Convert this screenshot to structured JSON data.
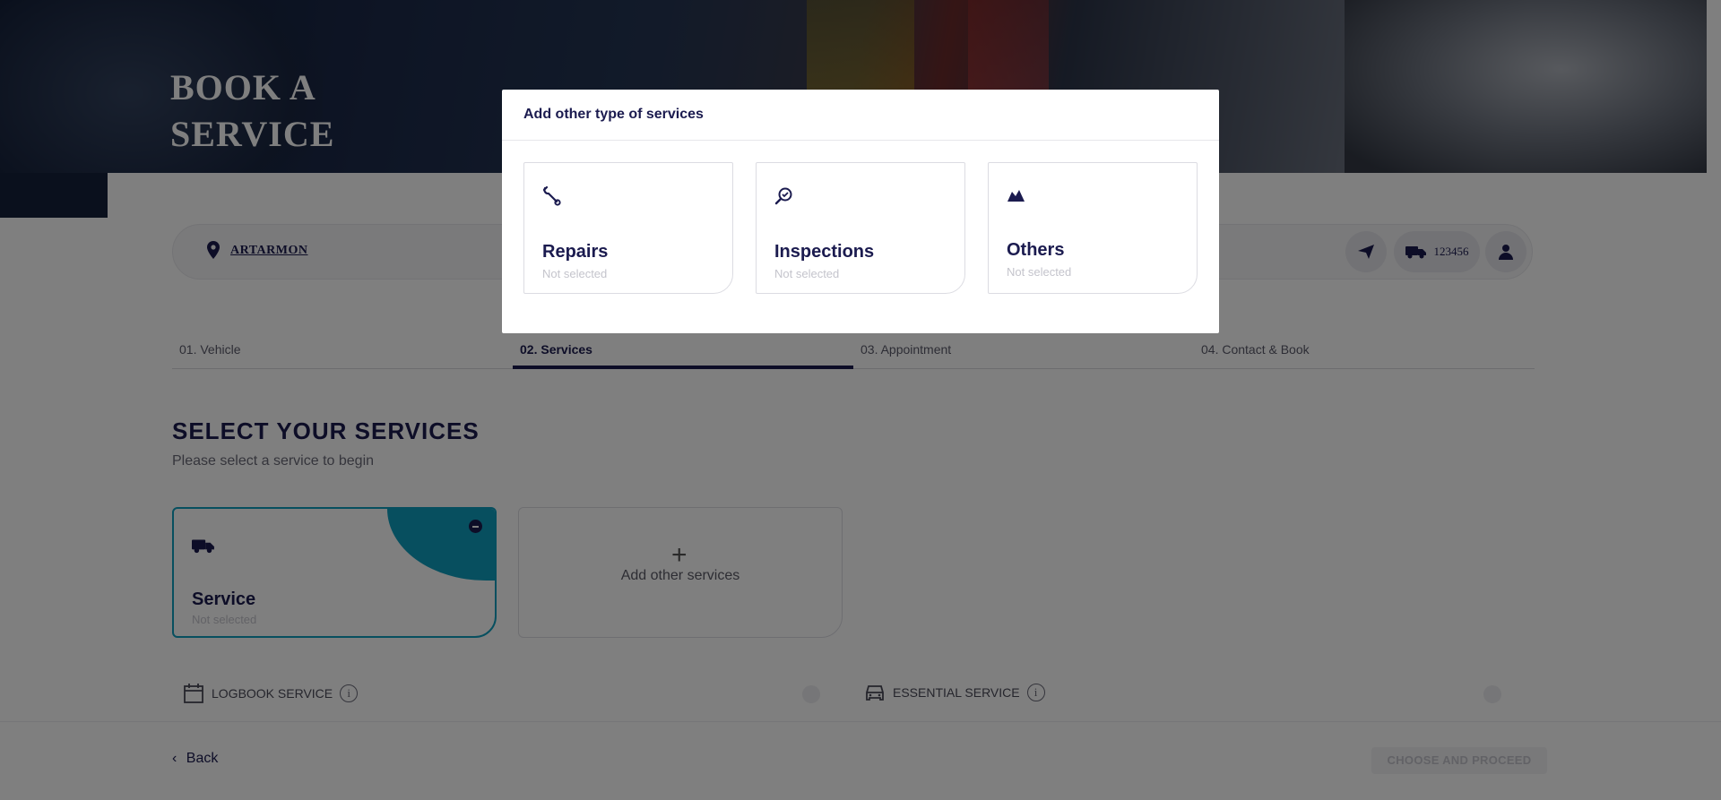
{
  "hero": {
    "title_line1": "BOOK A",
    "title_line2": "SERVICE"
  },
  "location": {
    "name": "ARTARMON"
  },
  "vehicle": {
    "rego": "123456"
  },
  "steps": [
    {
      "label": "01. Vehicle"
    },
    {
      "label": "02. Services"
    },
    {
      "label": "03. Appointment"
    },
    {
      "label": "04. Contact & Book"
    }
  ],
  "section": {
    "title": "SELECT YOUR SERVICES",
    "subtitle": "Please select a service to begin"
  },
  "service_card": {
    "name": "Service",
    "state": "Not selected"
  },
  "add_card": {
    "plus": "+",
    "label": "Add other services"
  },
  "options": [
    {
      "label": "LOGBOOK SERVICE",
      "info": "i"
    },
    {
      "label": "ESSENTIAL SERVICE",
      "info": "i"
    }
  ],
  "footer": {
    "back_label": "Back",
    "proceed_label": "CHOOSE AND PROCEED"
  },
  "modal": {
    "title": "Add other type of services",
    "cards": [
      {
        "name": "Repairs",
        "state": "Not selected",
        "icon": "wrench-icon"
      },
      {
        "name": "Inspections",
        "state": "Not selected",
        "icon": "magnifier-check-icon"
      },
      {
        "name": "Others",
        "state": "Not selected",
        "icon": "mountain-icon"
      }
    ]
  },
  "colors": {
    "navy": "#1b1b4f",
    "accent": "#0e9fbf"
  }
}
